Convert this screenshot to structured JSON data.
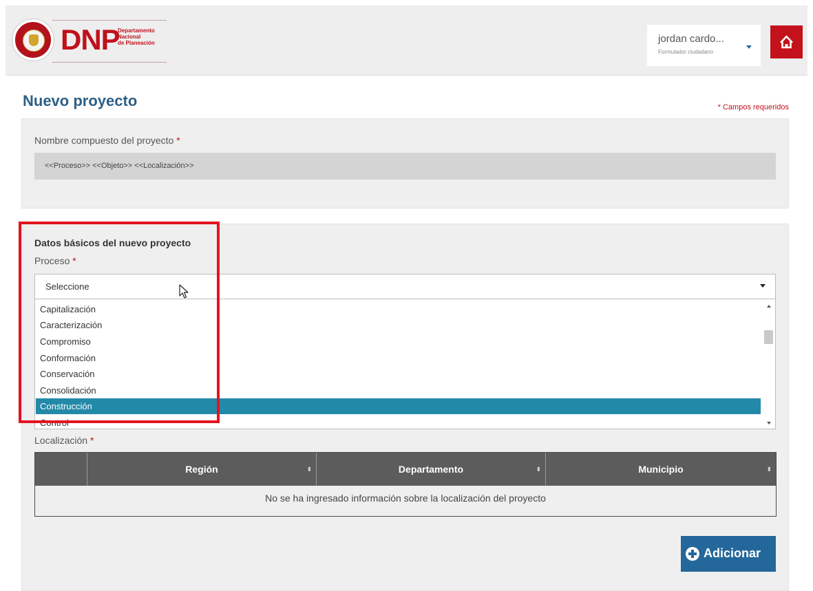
{
  "header": {
    "logo_text": "DNP",
    "logo_subtitle": [
      "Departamento",
      "Nacional",
      "de Planeación"
    ],
    "user_name": "jordan cardo...",
    "user_role": "Formulador ciudadano",
    "home_icon": "home-icon",
    "accent_color": "#c4121c"
  },
  "page": {
    "title": "Nuevo proyecto",
    "required_note": "* Campos requeridos"
  },
  "composite_name": {
    "label": "Nombre compuesto del proyecto",
    "required_mark": "*",
    "value": "<<Proceso>> <<Objeto>> <<Localización>>"
  },
  "basic_data": {
    "section_title": "Datos básicos del nuevo proyecto",
    "proceso_label": "Proceso",
    "required_mark": "*",
    "select_value": "Seleccione",
    "options": [
      "Capitalización",
      "Caracterización",
      "Compromiso",
      "Conformación",
      "Conservación",
      "Consolidación",
      "Construcción",
      "Control"
    ],
    "selected_option": "Construcción",
    "selected_color": "#2389a8"
  },
  "location": {
    "label": "Localización",
    "required_mark": "*",
    "columns": [
      "Región",
      "Departamento",
      "Municipio"
    ],
    "empty_message": "No se ha ingresado información sobre la localización del proyecto"
  },
  "actions": {
    "add_label": "Adicionar",
    "add_icon": "plus-circle-icon",
    "add_color": "#24679a"
  }
}
